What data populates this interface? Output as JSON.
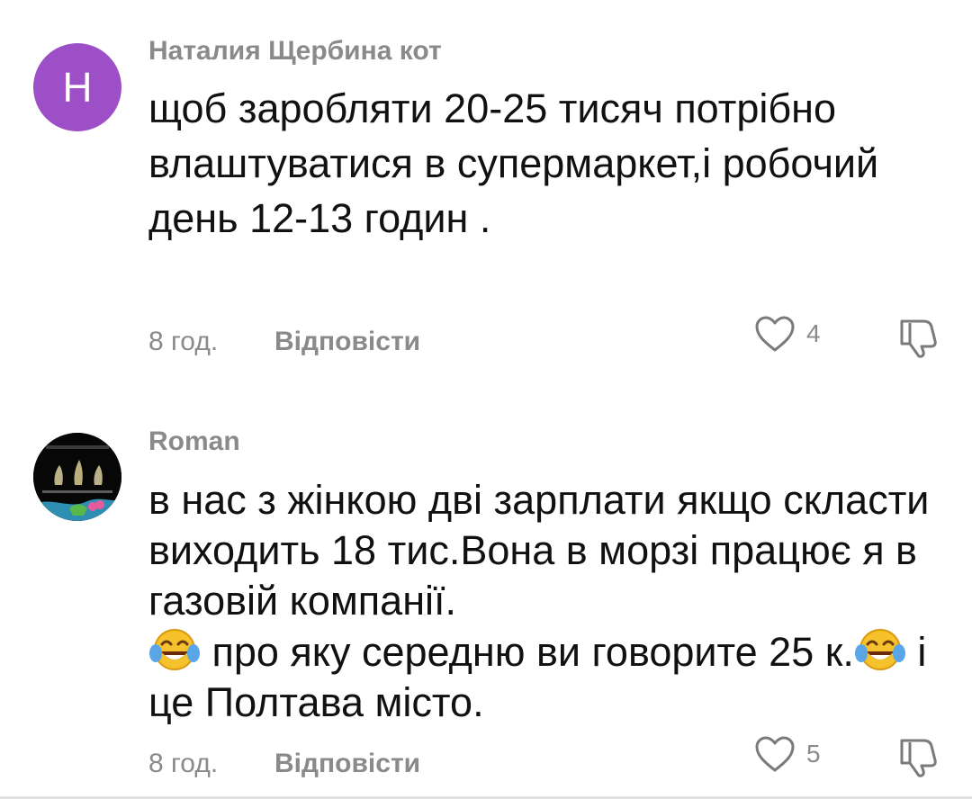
{
  "comments": [
    {
      "avatar_letter": "H",
      "author": "Наталия Щербина кот",
      "text": "щоб заробляти 20-25 тисяч потрібно влаштуватися в супермаркет,і робочий день 12-13 годин .",
      "time": "8 год.",
      "reply_label": "Відповісти",
      "likes": "4",
      "avatar_color": "#9c4fc6"
    },
    {
      "author": "Roman",
      "text_part1": "в нас з жінкою дві зарплати якщо скласти виходить 18 тис.Вона в морзі працює я в газовій компанії.",
      "text_part2": " про яку середню ви говорите 25 к.",
      "text_part3": " і це Полтава місто.",
      "time": "8 год.",
      "reply_label": "Відповісти",
      "likes": "5"
    }
  ],
  "icons": {
    "like": "heart-outline-icon",
    "dislike": "thumbs-down-outline-icon",
    "emoji": "face-with-tears-of-joy"
  }
}
